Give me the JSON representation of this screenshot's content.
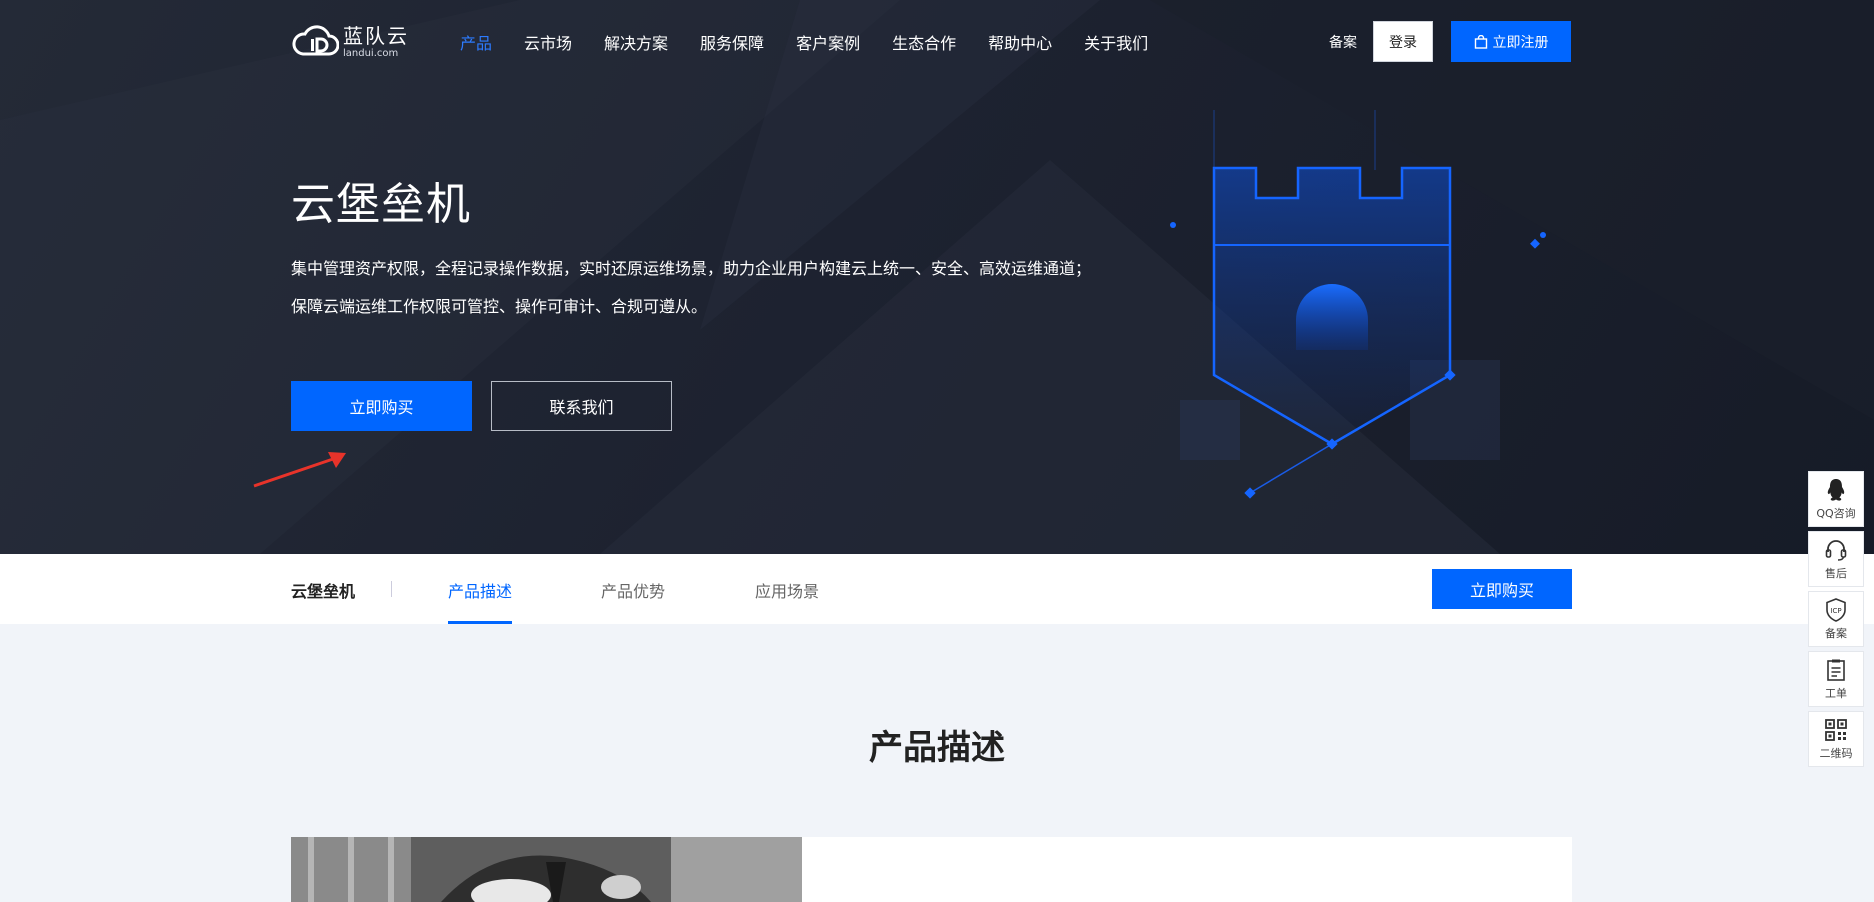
{
  "brand": {
    "name_cn": "蓝队云",
    "name_en": "landui.com"
  },
  "nav": {
    "items": [
      {
        "label": "产品",
        "active": true
      },
      {
        "label": "云市场"
      },
      {
        "label": "解决方案"
      },
      {
        "label": "服务保障"
      },
      {
        "label": "客户案例"
      },
      {
        "label": "生态合作"
      },
      {
        "label": "帮助中心"
      },
      {
        "label": "关于我们"
      }
    ],
    "beian": "备案",
    "login": "登录",
    "register": "立即注册"
  },
  "hero": {
    "title": "云堡垒机",
    "desc_line1": "集中管理资产权限，全程记录操作数据，实时还原运维场景，助力企业用户构建云上统一、安全、高效运维通道；",
    "desc_line2": "保障云端运维工作权限可管控、操作可审计、合规可遵从。",
    "buy_label": "立即购买",
    "contact_label": "联系我们"
  },
  "subnav": {
    "title": "云堡垒机",
    "tabs": [
      {
        "label": "产品描述",
        "active": true
      },
      {
        "label": "产品优势"
      },
      {
        "label": "应用场景"
      }
    ],
    "buy_label": "立即购买"
  },
  "section": {
    "title": "产品描述"
  },
  "side_widget": {
    "items": [
      {
        "label": "QQ咨询",
        "icon": "qq-icon"
      },
      {
        "label": "售后",
        "icon": "headset-icon"
      },
      {
        "label": "备案",
        "icon": "icp-shield-icon"
      },
      {
        "label": "工单",
        "icon": "clipboard-icon"
      },
      {
        "label": "二维码",
        "icon": "qrcode-icon"
      }
    ]
  },
  "colors": {
    "primary": "#0066ff",
    "hero_bg": "#1d2230",
    "nav_active": "#2d7bff",
    "arrow": "#e8332a"
  }
}
